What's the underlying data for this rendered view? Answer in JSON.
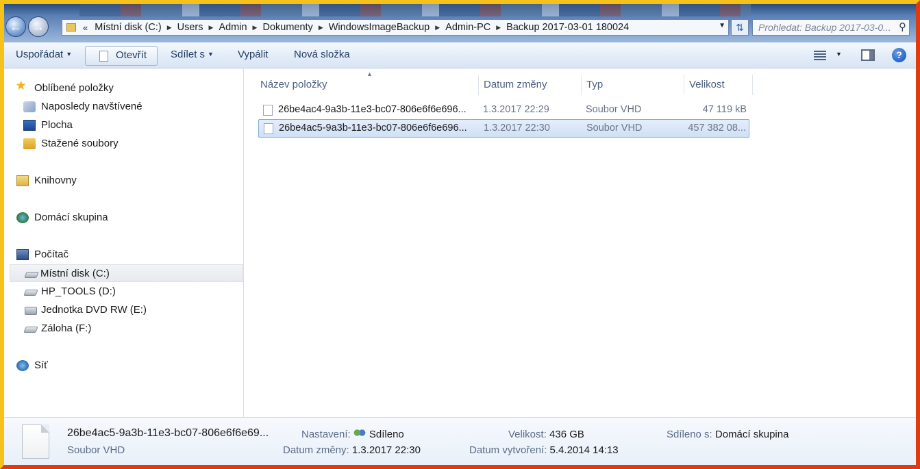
{
  "address": {
    "lead": "«",
    "crumbs": [
      "Místní disk (C:)",
      "Users",
      "Admin",
      "Dokumenty",
      "WindowsImageBackup",
      "Admin-PC",
      "Backup 2017-03-01 180024"
    ]
  },
  "search": {
    "placeholder": "Prohledat: Backup 2017-03-0..."
  },
  "toolbar": {
    "organize": "Uspořádat",
    "open": "Otevřít",
    "share": "Sdílet s",
    "burn": "Vypálit",
    "new_folder": "Nová složka",
    "help": "?"
  },
  "nav": {
    "favorites": "Oblíbené položky",
    "recent": "Naposledy navštívené",
    "desktop": "Plocha",
    "downloads": "Stažené soubory",
    "libraries": "Knihovny",
    "homegroup": "Domácí skupina",
    "computer": "Počítač",
    "drive_c": "Místní disk (C:)",
    "drive_d": "HP_TOOLS (D:)",
    "drive_e": "Jednotka DVD RW (E:)",
    "drive_f": "Záloha (F:)",
    "network": "Síť"
  },
  "columns": {
    "name": "Název položky",
    "date": "Datum změny",
    "type": "Typ",
    "size": "Velikost"
  },
  "files": [
    {
      "name": "26be4ac4-9a3b-11e3-bc07-806e6f6e696...",
      "date": "1.3.2017 22:29",
      "type": "Soubor VHD",
      "size": "47 119 kB"
    },
    {
      "name": "26be4ac5-9a3b-11e3-bc07-806e6f6e696...",
      "date": "1.3.2017 22:30",
      "type": "Soubor VHD",
      "size": "457 382 08..."
    }
  ],
  "details": {
    "name": "26be4ac5-9a3b-11e3-bc07-806e6f6e69...",
    "type": "Soubor VHD",
    "settings_label": "Nastavení:",
    "settings_value": "Sdíleno",
    "modified_label": "Datum změny:",
    "modified_value": "1.3.2017 22:30",
    "size_label": "Velikost:",
    "size_value": "436 GB",
    "created_label": "Datum vytvoření:",
    "created_value": "5.4.2014 14:13",
    "shared_label": "Sdíleno s:",
    "shared_value": "Domácí skupina"
  }
}
